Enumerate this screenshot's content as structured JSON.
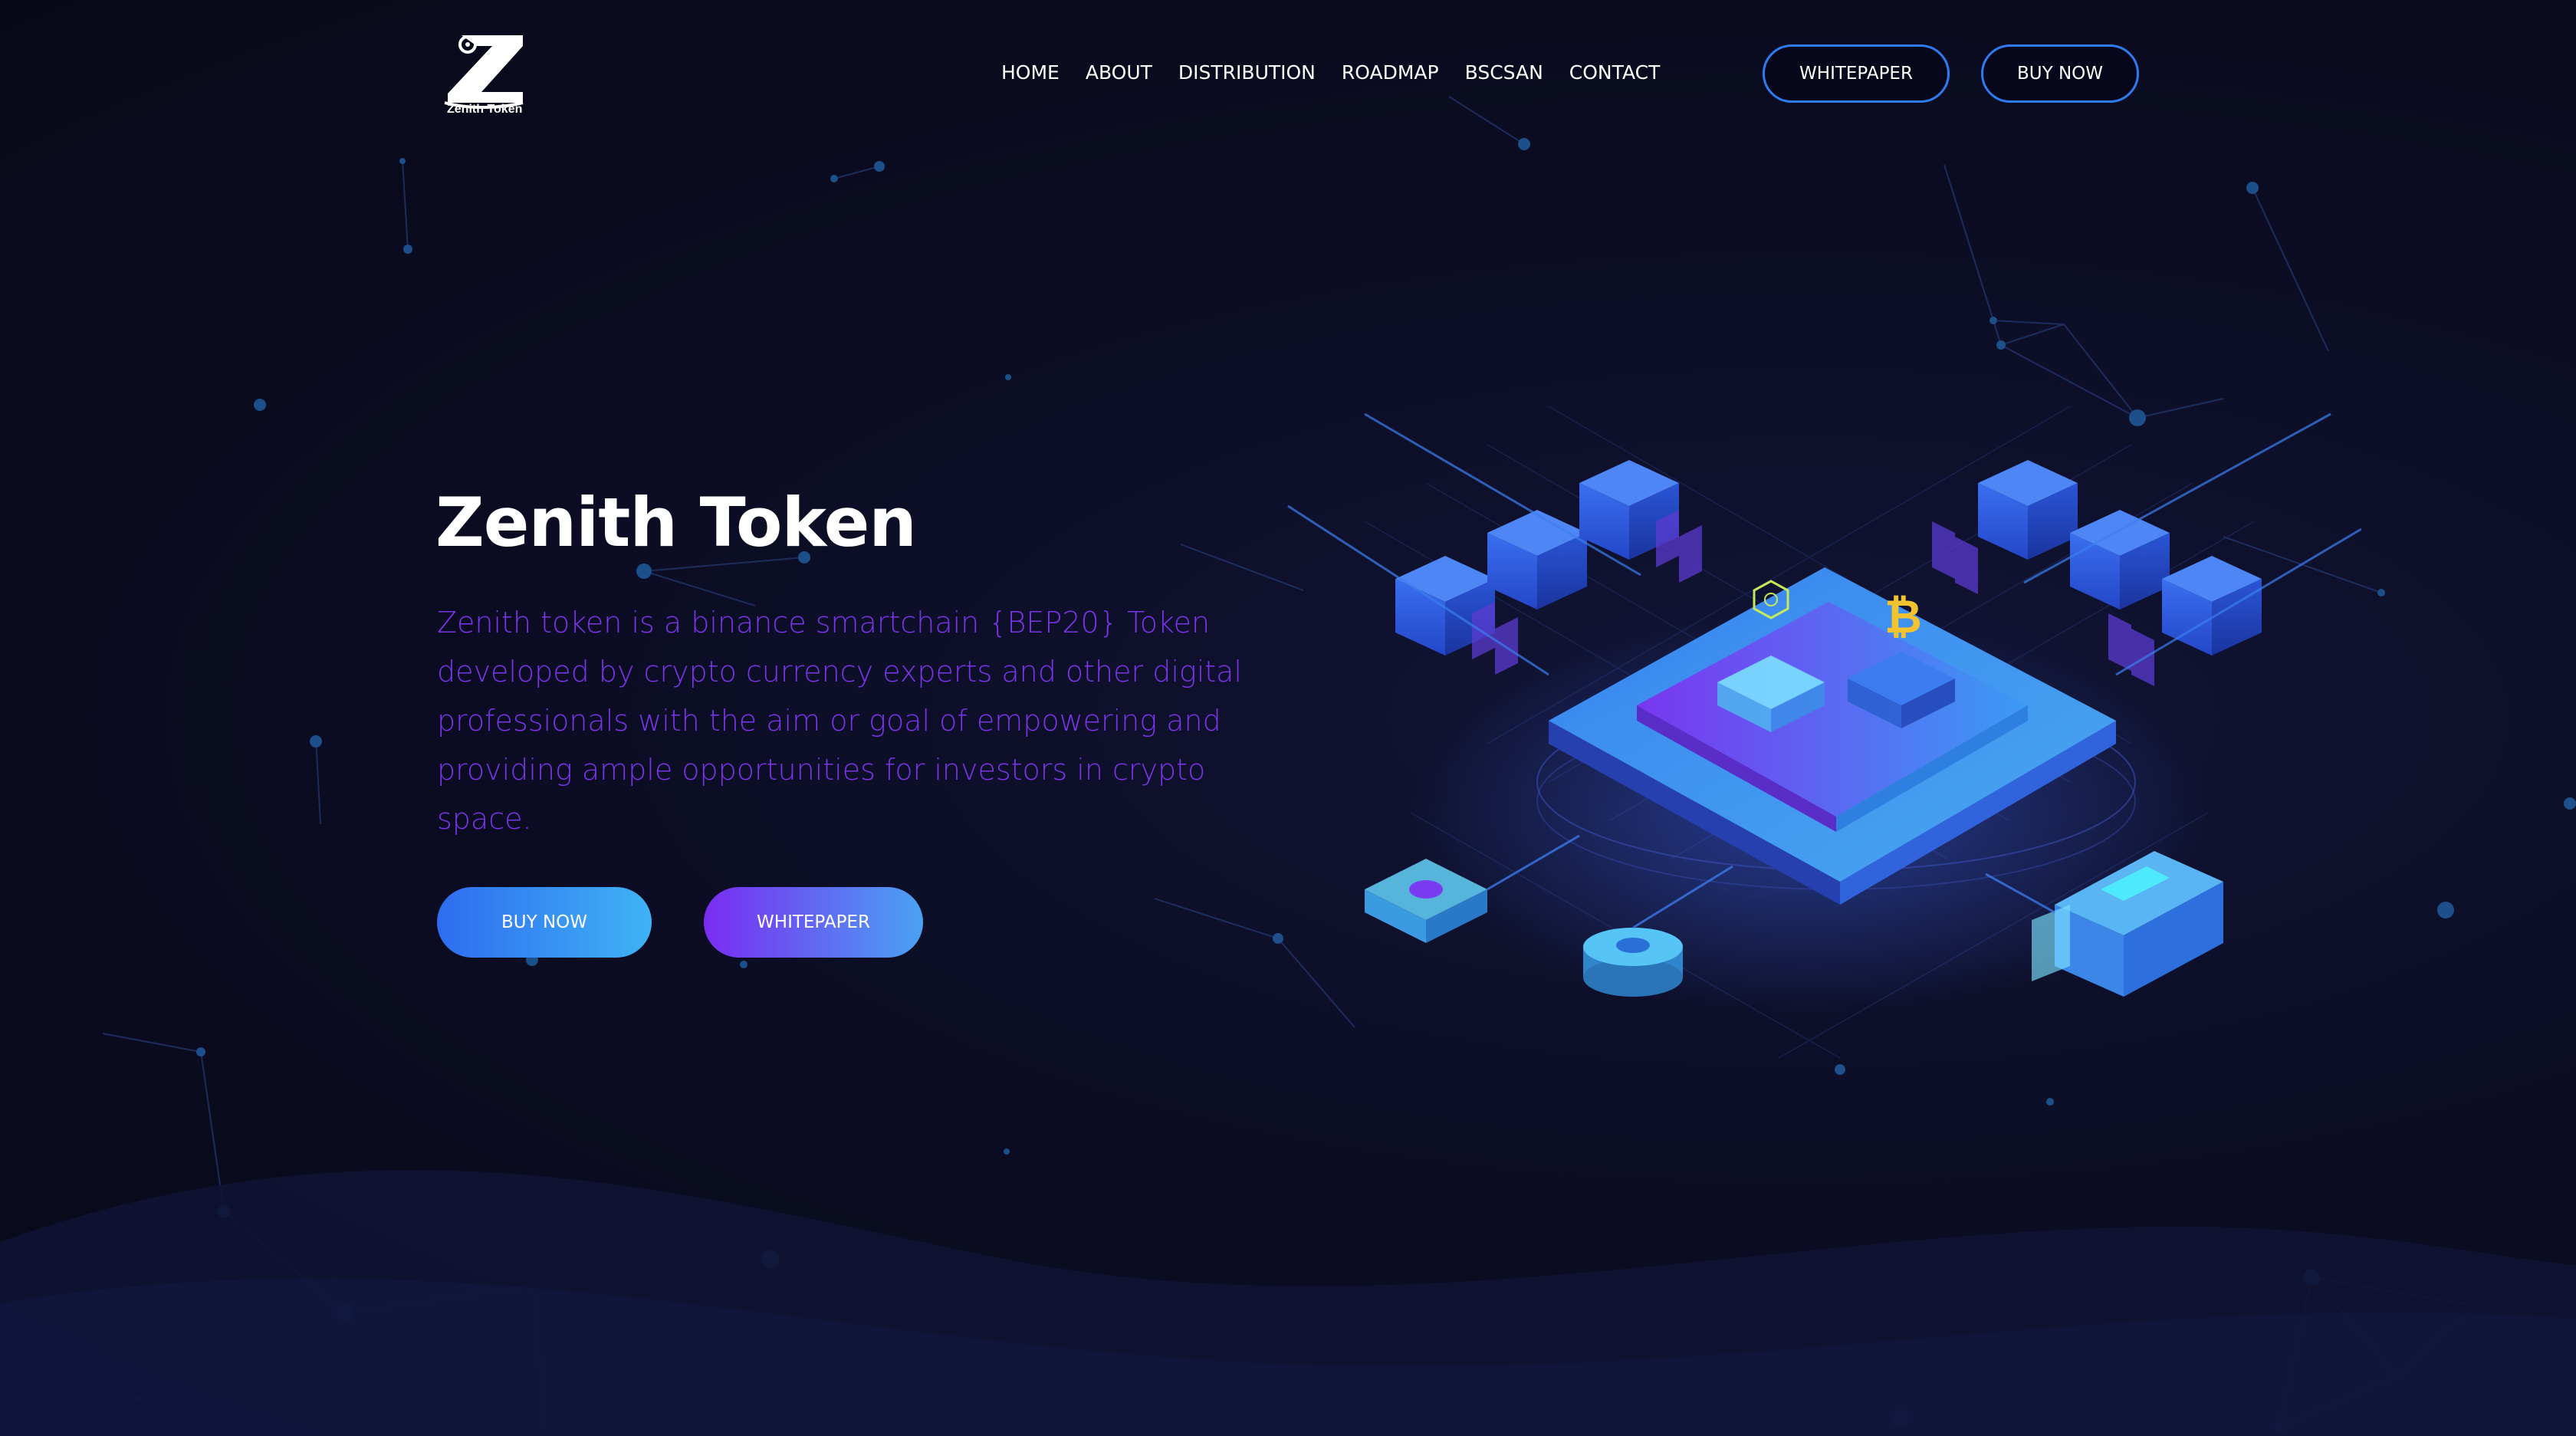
{
  "brand": {
    "logo_text": "Zenith Token"
  },
  "nav": {
    "items": [
      "HOME",
      "ABOUT",
      "DISTRIBUTION",
      "ROADMAP",
      "BSCSAN",
      "CONTACT"
    ]
  },
  "header_buttons": {
    "whitepaper": "WHITEPAPER",
    "buy_now": "BUY NOW"
  },
  "hero": {
    "title": "Zenith Token",
    "description": "Zenith token is a binance smartchain {BEP20} Token developed by crypto currency experts and other digital professionals with the aim or goal of empowering and providing ample opportunities for investors in crypto space.",
    "buy_now_label": "BUY NOW",
    "whitepaper_label": "WHITEPAPER"
  },
  "colors": {
    "background": "#0b0c22",
    "accent_blue": "#2e7bf0",
    "accent_purple": "#7a35e8",
    "text": "#ffffff"
  },
  "icons": {
    "logo": "zenith-z-logo",
    "illustration": "blockchain-isometric-illustration"
  }
}
